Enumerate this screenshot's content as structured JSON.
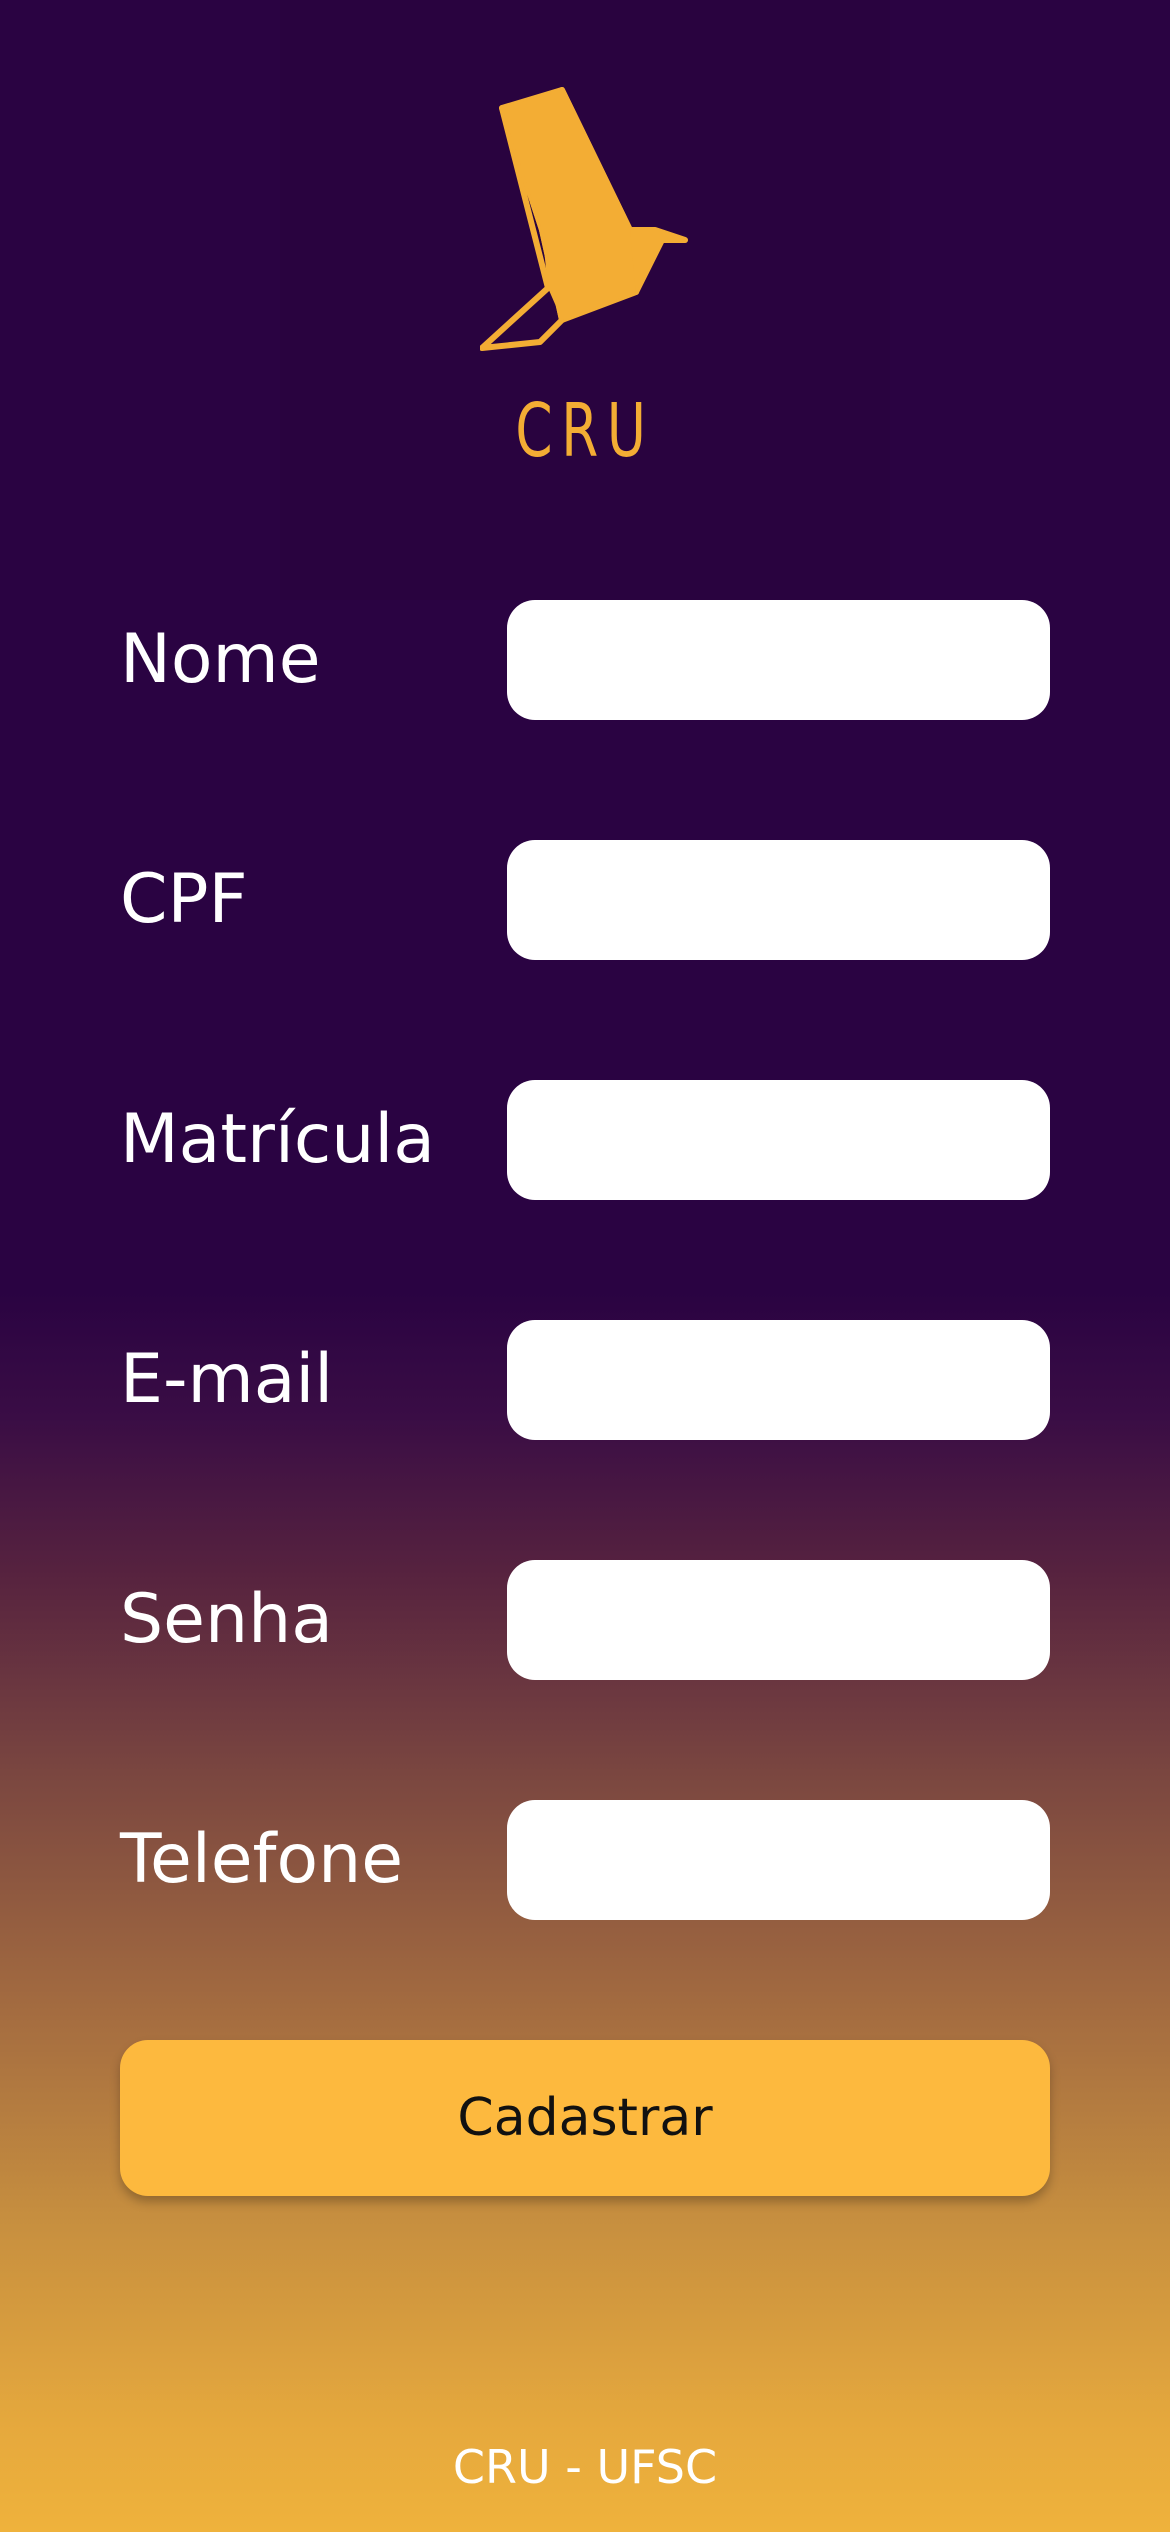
{
  "header": {
    "logo_icon": "origami-bird-icon",
    "logo_text": "CRU"
  },
  "form": {
    "fields": [
      {
        "label": "Nome",
        "value": "",
        "placeholder": ""
      },
      {
        "label": "CPF",
        "value": "",
        "placeholder": ""
      },
      {
        "label": "Matrícula",
        "value": "",
        "placeholder": ""
      },
      {
        "label": "E-mail",
        "value": "",
        "placeholder": ""
      },
      {
        "label": "Senha",
        "value": "",
        "placeholder": ""
      },
      {
        "label": "Telefone",
        "value": "",
        "placeholder": ""
      }
    ],
    "submit_label": "Cadastrar"
  },
  "footer": {
    "text": "CRU - UFSC"
  },
  "colors": {
    "background_top": "#2a0342",
    "background_bottom": "#efb23c",
    "accent": "#fdb93e",
    "logo": "#f3ad34"
  }
}
